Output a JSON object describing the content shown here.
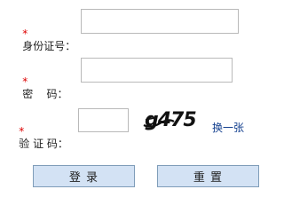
{
  "form": {
    "id_label": "身份证号：",
    "password_label": "密    码：",
    "captcha_label": "验 证 码：",
    "required_mark": "*",
    "id_value": "",
    "password_value": "",
    "captcha_value": "",
    "captcha_text": "g475",
    "refresh_label": "换一张",
    "login_label": "登  录",
    "reset_label": "重  置"
  },
  "colors": {
    "required": "#dd0000",
    "link": "#14408f",
    "button_bg": "#d3e2f4",
    "button_border": "#7f9db9",
    "input_border": "#b9b9b9"
  }
}
